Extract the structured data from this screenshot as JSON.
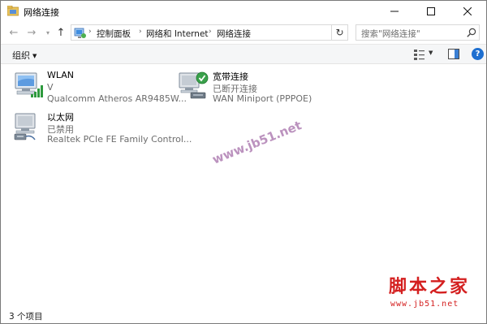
{
  "window": {
    "title": "网络连接",
    "minimize_icon": "minimize-icon",
    "maximize_icon": "maximize-icon",
    "close_icon": "close-icon"
  },
  "address_bar": {
    "breadcrumbs": [
      "控制面板",
      "网络和 Internet",
      "网络连接"
    ],
    "search_placeholder": "搜索\"网络连接\""
  },
  "command_bar": {
    "organize_label": "组织"
  },
  "connections": [
    {
      "name": "WLAN",
      "status": "V",
      "device": "Qualcomm Atheros AR9485W...",
      "icon": "wifi-adapter-icon"
    },
    {
      "name": "宽带连接",
      "status": "已断开连接",
      "device": "WAN Miniport (PPPOE)",
      "icon": "broadband-icon"
    },
    {
      "name": "以太网",
      "status": "已禁用",
      "device": "Realtek PCIe FE Family Control...",
      "icon": "ethernet-adapter-icon"
    }
  ],
  "status_bar": {
    "item_count": "3 个项目"
  },
  "watermark": {
    "text": "www.jb51.net"
  },
  "site_logo": {
    "title": "脚本之家",
    "url": "www.jb51.net"
  },
  "colors": {
    "accent": "#1e6fd0",
    "status_text": "#6d6d6d",
    "logo_red": "#d41f1f"
  }
}
